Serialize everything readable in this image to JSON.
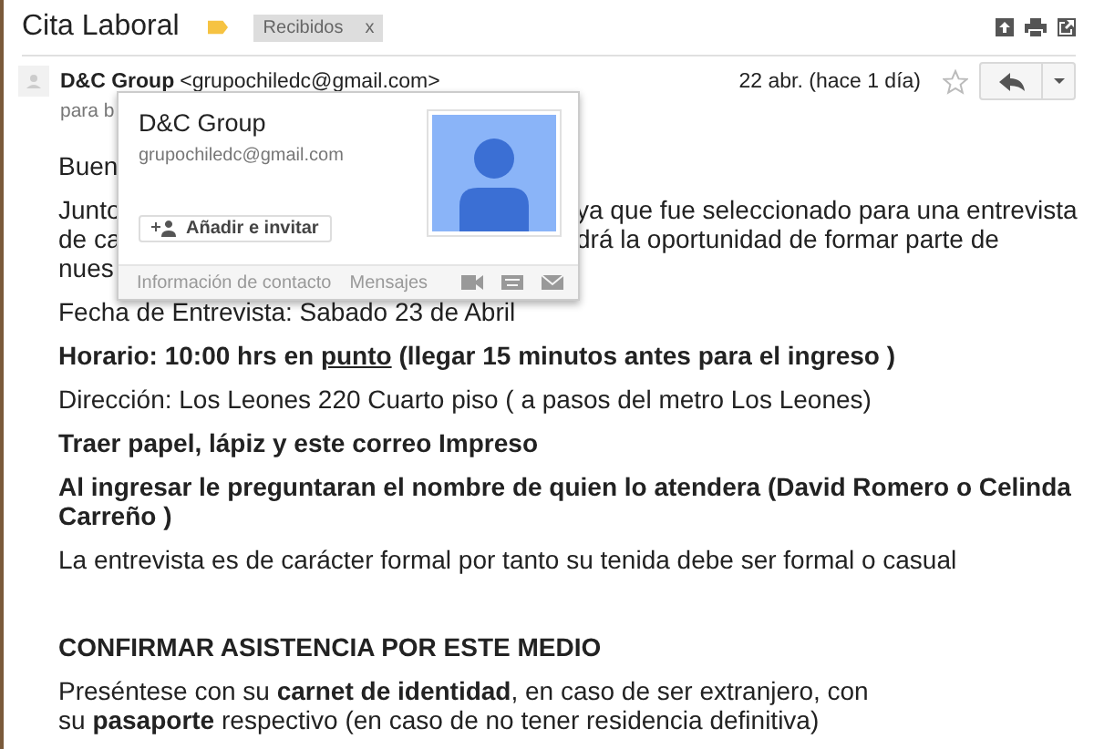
{
  "thread": {
    "title": "Cita Laboral",
    "labels": [
      {
        "text": "Recibidos",
        "remove": "x"
      }
    ]
  },
  "message": {
    "sender_name": "D&C Group",
    "sender_email": "<grupochiledc@gmail.com>",
    "recipient": "para b",
    "date": "22 abr. (hace 1 día)",
    "starred": false
  },
  "contact_card": {
    "name": "D&C Group",
    "email": "grupochiledc@gmail.com",
    "add_button": "Añadir e invitar",
    "links": [
      "Información de contacto",
      "Mensajes"
    ]
  },
  "body": [
    {
      "kind": "covered",
      "lines": [
        {
          "left": "Buen"
        }
      ]
    },
    {
      "kind": "covered",
      "lines": [
        {
          "left": "Junto",
          "right": "ya que fue seleccionado para una entrevista"
        },
        {
          "left": "de ca",
          "right": "drá la oportunidad de formar parte de"
        },
        {
          "left": "nues"
        }
      ]
    },
    {
      "kind": "paragraph",
      "bold": false,
      "lines": [
        "Fecha de Entrevista: Sabado 23 de Abril"
      ]
    },
    {
      "kind": "segments",
      "bold": true,
      "segments": [
        {
          "text": "Horario: 10:00 hrs en ",
          "underline": false
        },
        {
          "text": "punto",
          "underline": true
        },
        {
          "text": " (llegar 15 minutos antes para el ingreso )",
          "underline": false
        }
      ]
    },
    {
      "kind": "paragraph",
      "bold": false,
      "lines": [
        "Dirección: Los Leones 220 Cuarto piso ( a pasos del metro Los Leones)"
      ]
    },
    {
      "kind": "paragraph",
      "bold": true,
      "lines": [
        "Traer papel, lápiz y este correo Impreso"
      ]
    },
    {
      "kind": "paragraph",
      "bold": true,
      "lines": [
        "Al ingresar le preguntaran el nombre de quien lo atendera (David Romero o Celinda",
        "Carreño )"
      ]
    },
    {
      "kind": "paragraph",
      "bold": false,
      "lines": [
        "La entrevista es de carácter formal por tanto su tenida debe ser formal o casual"
      ]
    },
    {
      "kind": "blank"
    },
    {
      "kind": "paragraph",
      "bold": true,
      "lines": [
        "CONFIRMAR ASISTENCIA POR ESTE MEDIO"
      ]
    },
    {
      "kind": "paragraph",
      "bold": false,
      "lines": [
        "Preséntese con su **carnet de identidad**, en caso de ser extranjero, con",
        "su **pasaporte** respectivo (en caso de no tener residencia definitiva)"
      ]
    }
  ]
}
